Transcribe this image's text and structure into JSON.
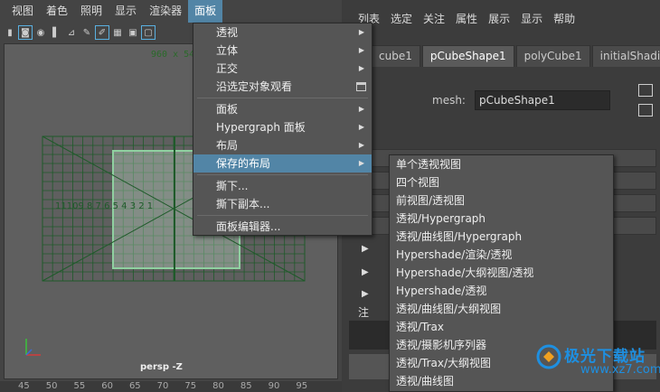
{
  "menubar": {
    "items": [
      "视图",
      "着色",
      "照明",
      "显示",
      "渲染器",
      "面板"
    ]
  },
  "viewport": {
    "resolution": "960 x 540",
    "camera": "persp -Z",
    "grid_labels": "11109 8 7 6 5 4 3 2 1"
  },
  "ruler": {
    "ticks": [
      "45",
      "50",
      "55",
      "60",
      "65",
      "70",
      "75",
      "80",
      "85",
      "90",
      "95"
    ]
  },
  "attr_editor": {
    "menu": [
      "列表",
      "选定",
      "关注",
      "属性",
      "展示",
      "显示",
      "帮助"
    ],
    "tabs": [
      "cube1",
      "pCubeShape1",
      "polyCube1",
      "initialShading"
    ],
    "mesh_label": "mesh:",
    "mesh_value": "pCubeShape1",
    "bottom_label": "注"
  },
  "panel_menu": {
    "items": [
      {
        "label": "透视",
        "arrow": true
      },
      {
        "label": "立体",
        "arrow": true
      },
      {
        "label": "正交",
        "arrow": true
      },
      {
        "label": "沿选定对象观看",
        "icon": "window-icon"
      },
      {
        "label": "面板",
        "arrow": true
      },
      {
        "label": "Hypergraph 面板",
        "arrow": true
      },
      {
        "label": "布局",
        "arrow": true
      },
      {
        "label": "保存的布局",
        "arrow": true,
        "selected": true
      },
      {
        "label": "撕下..."
      },
      {
        "label": "撕下副本..."
      },
      {
        "label": "面板编辑器..."
      }
    ]
  },
  "layout_menu": {
    "items": [
      "单个透视视图",
      "四个视图",
      "前视图/透视图",
      "透视/Hypergraph",
      "透视/曲线图/Hypergraph",
      "Hypershade/渲染/透视",
      "Hypershade/大纲视图/透视",
      "Hypershade/透视",
      "透视/曲线图/大纲视图",
      "透视/Trax",
      "透视/摄影机序列器",
      "透视/Trax/大纲视图",
      "透视/曲线图"
    ]
  },
  "watermark": {
    "text": "极光下载站",
    "url": "www.xz7.com"
  },
  "colors": {
    "accent": "#5285a6",
    "grid": "#1f5a2a",
    "grid_highlight": "#8fd0a0"
  }
}
